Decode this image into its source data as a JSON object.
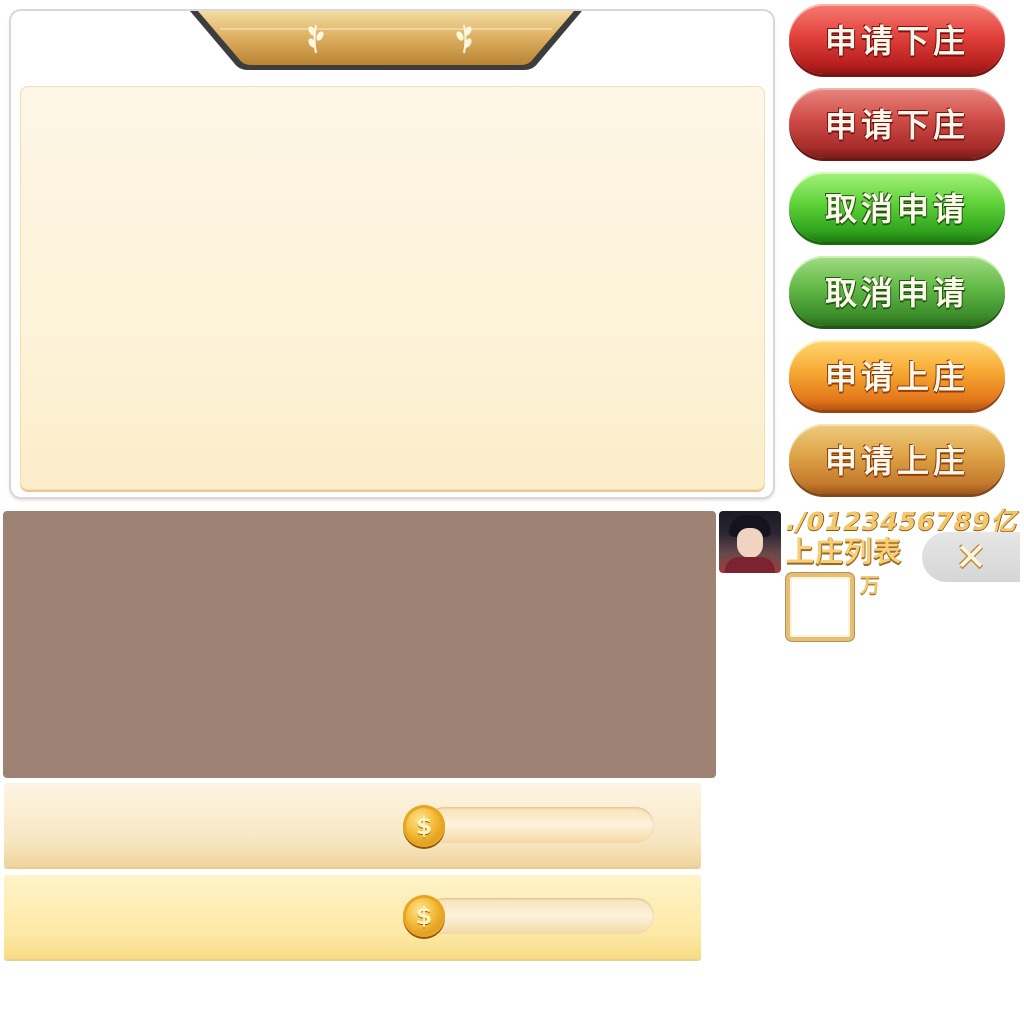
{
  "buttons": {
    "apply_off_banker_1": "申请下庄",
    "apply_off_banker_2": "申请下庄",
    "cancel_apply_1": "取消申请",
    "cancel_apply_2": "取消申请",
    "apply_banker_1": "申请上庄",
    "apply_banker_2": "申请上庄"
  },
  "number_font_strip": "./0123456789亿",
  "banker_list_title": "上庄列表",
  "unit_wan": "万",
  "close_symbol": "✕",
  "coin_symbol": "$",
  "colors": {
    "red": "#e2433d",
    "green": "#5fd23a",
    "orange": "#f7a933",
    "gold_text": "#f4c86a",
    "list_background": "#9e8274",
    "panel_cream": "#fdf3d9"
  },
  "icons": {
    "title_decor_left": "laurel-icon",
    "title_decor_right": "laurel-icon",
    "close": "close-icon",
    "coin": "coin-icon"
  }
}
